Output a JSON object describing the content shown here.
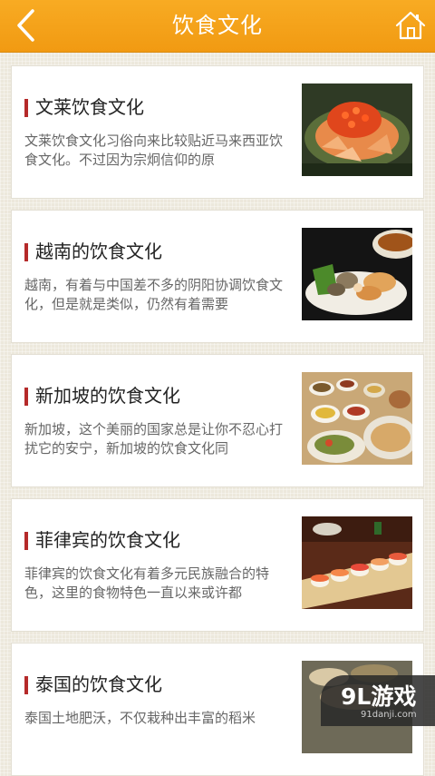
{
  "header": {
    "title": "饮食文化",
    "back_icon": "back-arrow-icon",
    "home_icon": "home-icon",
    "color": "#f5a21c"
  },
  "articles": [
    {
      "title": "文莱饮食文化",
      "description": "文莱饮食文化习俗向来比较贴近马来西亚饮食文化。不过因为宗炯信仰的原",
      "image": "salmon-roe-salad-photo"
    },
    {
      "title": "越南的饮食文化",
      "description": "越南，有着与中国差不多的阴阳协调饮食文化，但是就是类似，仍然有着需要",
      "image": "seafood-platter-photo"
    },
    {
      "title": "新加坡的饮食文化",
      "description": "新加坡，这个美丽的国家总是让你不忍心打扰它的安宁，新加坡的饮食文化同",
      "image": "asian-dishes-spread-photo"
    },
    {
      "title": "菲律宾的饮食文化",
      "description": "菲律宾的饮食文化有着多元民族融合的特色，这里的食物特色一直以来或许都",
      "image": "sushi-platter-photo"
    },
    {
      "title": "泰国的饮食文化",
      "description": "泰国土地肥沃，不仅栽种出丰富的稻米",
      "image": "thai-dishes-photo"
    }
  ],
  "watermark": {
    "logo": "9L游戏",
    "site": "91danji.com"
  }
}
